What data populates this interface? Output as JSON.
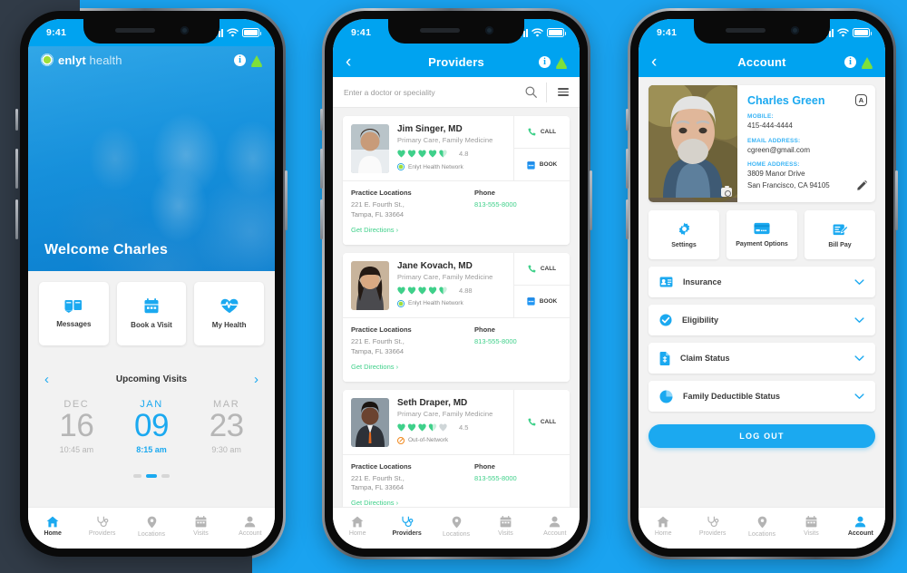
{
  "background": {
    "accent": "#00a3f0",
    "dark_panel": "#313b47"
  },
  "status_bar": {
    "time": "9:41"
  },
  "phone1": {
    "brand": {
      "name_bold": "enlyt",
      "name_light": " health"
    },
    "header_icons": {
      "info": "i",
      "bell": "bell-icon"
    },
    "welcome": "Welcome Charles",
    "tiles": [
      {
        "label": "Messages",
        "icon": "messages-icon"
      },
      {
        "label": "Book a Visit",
        "icon": "calendar-icon"
      },
      {
        "label": "My Health",
        "icon": "heartbeat-icon"
      }
    ],
    "upcoming": {
      "title": "Upcoming Visits",
      "prev": "‹",
      "next": "›",
      "visits": [
        {
          "month": "DEC",
          "day": "16",
          "time": "10:45 am",
          "active": false
        },
        {
          "month": "JAN",
          "day": "09",
          "time": "8:15 am",
          "active": true
        },
        {
          "month": "MAR",
          "day": "23",
          "time": "9:30 am",
          "active": false
        }
      ],
      "page_dots": 3,
      "active_dot": 1
    },
    "tabs": [
      {
        "label": "Home",
        "icon": "home-icon",
        "active": true
      },
      {
        "label": "Providers",
        "icon": "stethoscope-icon",
        "active": false
      },
      {
        "label": "Locations",
        "icon": "map-pin-icon",
        "active": false
      },
      {
        "label": "Visits",
        "icon": "calendar-icon",
        "active": false
      },
      {
        "label": "Account",
        "icon": "person-icon",
        "active": false
      }
    ]
  },
  "phone2": {
    "nav": {
      "back": "‹",
      "title": "Providers"
    },
    "search": {
      "placeholder": "Enter a doctor or speciality",
      "icon": "search-icon",
      "filter_icon": "filter-icon"
    },
    "column_headers": {
      "locations": "Practice Locations",
      "phone": "Phone"
    },
    "directions_label": "Get Directions ›",
    "providers": [
      {
        "name": "Jim Singer, MD",
        "specialty": "Primary Care, Family Medicine",
        "rating": "4.8",
        "hearts_full": 4,
        "hearts_half": 1,
        "network": "Enlyt Health Network",
        "in_network": true,
        "address_line1": "221 E. Fourth St.,",
        "address_line2": "Tampa, FL 33664",
        "phone": "813-555-8000",
        "actions": [
          "CALL",
          "BOOK"
        ]
      },
      {
        "name": "Jane Kovach, MD",
        "specialty": "Primary Care, Family Medicine",
        "rating": "4.88",
        "hearts_full": 4,
        "hearts_half": 1,
        "network": "Enlyt Health Network",
        "in_network": true,
        "address_line1": "221 E. Fourth St.,",
        "address_line2": "Tampa, FL 33664",
        "phone": "813-555-8000",
        "actions": [
          "CALL",
          "BOOK"
        ]
      },
      {
        "name": "Seth Draper, MD",
        "specialty": "Primary Care, Family Medicine",
        "rating": "4.5",
        "hearts_full": 3,
        "hearts_half": 1,
        "network": "Out-of-Network",
        "in_network": false,
        "address_line1": "221 E. Fourth St.,",
        "address_line2": "Tampa, FL 33664",
        "phone": "813-555-8000",
        "actions": [
          "CALL"
        ]
      }
    ],
    "tabs": [
      {
        "label": "Home",
        "icon": "home-icon",
        "active": false
      },
      {
        "label": "Providers",
        "icon": "stethoscope-icon",
        "active": true
      },
      {
        "label": "Locations",
        "icon": "map-pin-icon",
        "active": false
      },
      {
        "label": "Visits",
        "icon": "calendar-icon",
        "active": false
      },
      {
        "label": "Account",
        "icon": "person-icon",
        "active": false
      }
    ]
  },
  "phone3": {
    "nav": {
      "back": "‹",
      "title": "Account"
    },
    "profile": {
      "name": "Charles Green",
      "badge": "A",
      "mobile_label": "MOBILE:",
      "mobile": "415-444-4444",
      "email_label": "EMAIL ADDRESS:",
      "email": "cgreen@gmail.com",
      "home_label": "HOME ADDRESS:",
      "home_line1": "3809 Manor Drive",
      "home_line2": "San Francisco, CA 94105",
      "edit_icon": "pencil-icon",
      "camera_icon": "camera-icon"
    },
    "options": [
      {
        "label": "Settings",
        "icon": "gear-icon"
      },
      {
        "label": "Payment Options",
        "icon": "credit-card-icon"
      },
      {
        "label": "Bill Pay",
        "icon": "bill-pay-icon"
      }
    ],
    "accordions": [
      {
        "label": "Insurance",
        "icon": "id-card-icon"
      },
      {
        "label": "Eligibility",
        "icon": "check-badge-icon"
      },
      {
        "label": "Claim Status",
        "icon": "document-icon"
      },
      {
        "label": "Family Deductible Status",
        "icon": "pie-chart-icon"
      }
    ],
    "logout_label": "LOG OUT",
    "tabs": [
      {
        "label": "Home",
        "icon": "home-icon",
        "active": false
      },
      {
        "label": "Providers",
        "icon": "stethoscope-icon",
        "active": false
      },
      {
        "label": "Locations",
        "icon": "map-pin-icon",
        "active": false
      },
      {
        "label": "Visits",
        "icon": "calendar-icon",
        "active": false
      },
      {
        "label": "Account",
        "icon": "person-icon",
        "active": true
      }
    ]
  }
}
